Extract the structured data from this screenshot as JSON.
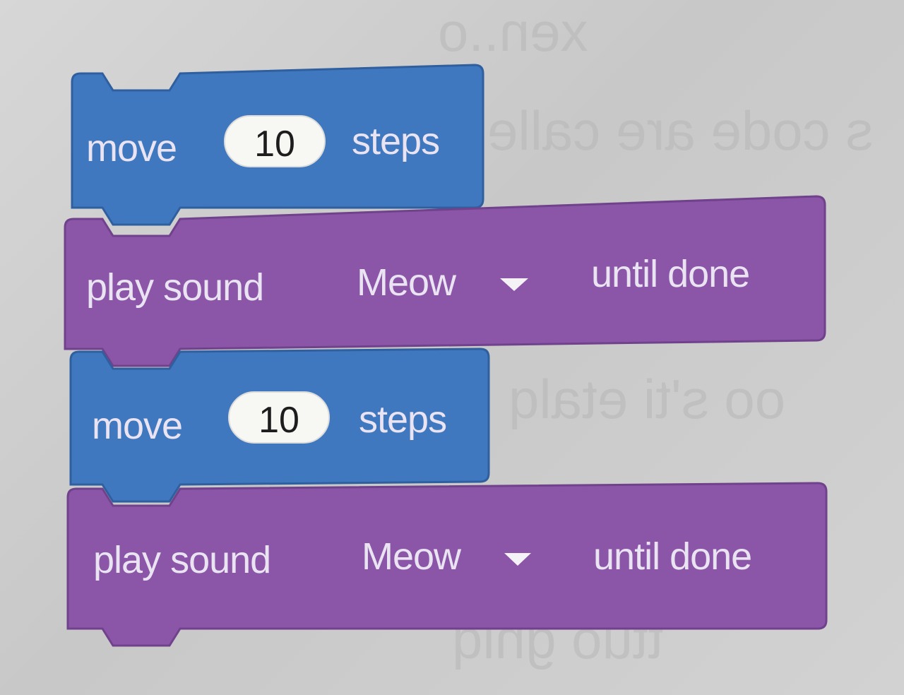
{
  "workspace": {
    "blocks": [
      {
        "category": "motion",
        "color": "#3f78bf",
        "label_prefix": "move",
        "input_value": "10",
        "label_suffix": "steps"
      },
      {
        "category": "sound",
        "color": "#8b55a8",
        "label_prefix": "play sound",
        "menu_value": "Meow",
        "menu_icon": "dropdown-arrow-icon",
        "label_suffix": "until done"
      },
      {
        "category": "motion",
        "color": "#3f78bf",
        "label_prefix": "move",
        "input_value": "10",
        "label_suffix": "steps"
      },
      {
        "category": "sound",
        "color": "#8b55a8",
        "label_prefix": "play sound",
        "menu_value": "Meow",
        "menu_icon": "dropdown-arrow-icon",
        "label_suffix": "until done"
      }
    ]
  }
}
